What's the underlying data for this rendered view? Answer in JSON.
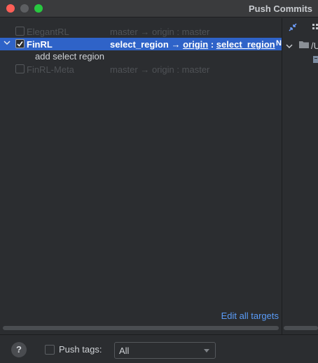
{
  "window": {
    "title": "Push Commits"
  },
  "repos": [
    {
      "name": "ElegantRL",
      "source": "master",
      "arrow": "→",
      "remote": "origin",
      "sep": ":",
      "target": "master"
    },
    {
      "name": "FinRL",
      "source": "select_region",
      "arrow": "→",
      "remote": "origin",
      "sep": ":",
      "target": "select_region",
      "tag": "N",
      "commit": "add select region"
    },
    {
      "name": "FinRL-Meta",
      "source": "master",
      "arrow": "→",
      "remote": "origin",
      "sep": ":",
      "target": "master"
    }
  ],
  "links": {
    "edit_all_targets": "Edit all targets"
  },
  "bottom": {
    "help": "?",
    "push_tags_label": "Push tags:",
    "push_tags_value": "All"
  },
  "right_panel": {
    "path_text": "/U",
    "collapse_icon": "collapse-arrows-icon",
    "grid_icon": "grid-icon",
    "folder_icon": "folder-icon"
  }
}
